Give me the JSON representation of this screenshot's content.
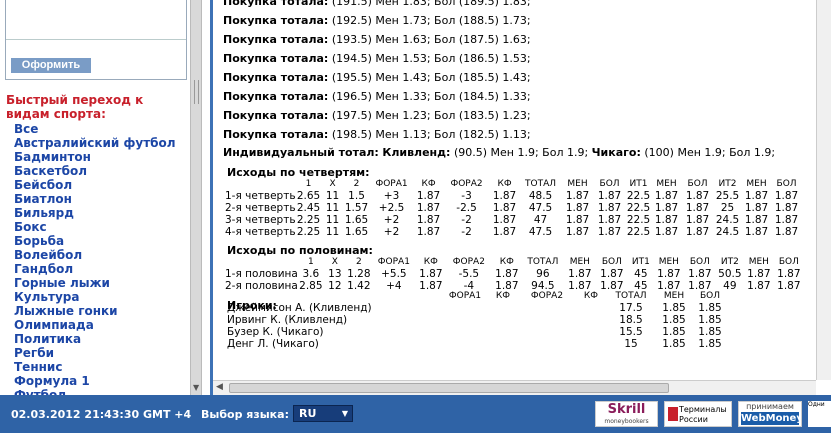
{
  "sidebar": {
    "order_button": "Оформить",
    "quick_title": "Быстрый переход к видам спорта:",
    "sports": [
      "Все",
      "Австралийский футбол",
      "Бадминтон",
      "Баскетбол",
      "Бейсбол",
      "Биатлон",
      "Бильярд",
      "Бокс",
      "Борьба",
      "Волейбол",
      "Гандбол",
      "Горные лыжи",
      "Культура",
      "Лыжные гонки",
      "Олимпиада",
      "Политика",
      "Регби",
      "Теннис",
      "Формула 1",
      "Футбол"
    ]
  },
  "totals": {
    "label": "Покупка тотала:",
    "lines": [
      "(191.5) Мен 1.83; Бол (189.5) 1.83;",
      "(192.5) Мен 1.73; Бол (188.5) 1.73;",
      "(193.5) Мен 1.63; Бол (187.5) 1.63;",
      "(194.5) Мен 1.53; Бол (186.5) 1.53;",
      "(195.5) Мен 1.43; Бол (185.5) 1.43;",
      "(196.5) Мен 1.33; Бол (184.5) 1.33;",
      "(197.5) Мен 1.23; Бол (183.5) 1.23;",
      "(198.5) Мен 1.13; Бол (182.5) 1.13;"
    ]
  },
  "individual": {
    "label": "Индивидуальный тотал:",
    "team1": "Кливленд:",
    "val1": "(90.5) Мен 1.9; Бол 1.9;",
    "team2": "Чикаго:",
    "val2": "(100) Мен 1.9; Бол 1.9;"
  },
  "quarters": {
    "title": "Исходы по четвертям:",
    "headers": [
      "1",
      "X",
      "2",
      "ФОРА1",
      "КФ",
      "ФОРА2",
      "КФ",
      "ТОТАЛ",
      "МЕН",
      "БОЛ",
      "ИТ1",
      "МЕН",
      "БОЛ",
      "ИТ2",
      "МЕН",
      "БОЛ"
    ],
    "rows": [
      {
        "label": "1-я четверть",
        "cells": [
          "2.65",
          "11",
          "1.5",
          "+3",
          "1.87",
          "-3",
          "1.87",
          "48.5",
          "1.87",
          "1.87",
          "22.5",
          "1.87",
          "1.87",
          "25.5",
          "1.87",
          "1.87"
        ]
      },
      {
        "label": "2-я четверть",
        "cells": [
          "2.45",
          "11",
          "1.57",
          "+2.5",
          "1.87",
          "-2.5",
          "1.87",
          "47.5",
          "1.87",
          "1.87",
          "22.5",
          "1.87",
          "1.87",
          "25",
          "1.87",
          "1.87"
        ]
      },
      {
        "label": "3-я четверть",
        "cells": [
          "2.25",
          "11",
          "1.65",
          "+2",
          "1.87",
          "-2",
          "1.87",
          "47",
          "1.87",
          "1.87",
          "22.5",
          "1.87",
          "1.87",
          "24.5",
          "1.87",
          "1.87"
        ]
      },
      {
        "label": "4-я четверть",
        "cells": [
          "2.25",
          "11",
          "1.65",
          "+2",
          "1.87",
          "-2",
          "1.87",
          "47.5",
          "1.87",
          "1.87",
          "22.5",
          "1.87",
          "1.87",
          "24.5",
          "1.87",
          "1.87"
        ]
      }
    ]
  },
  "halves": {
    "title": "Исходы по половинам:",
    "headers": [
      "1",
      "X",
      "2",
      "ФОРА1",
      "КФ",
      "ФОРА2",
      "КФ",
      "ТОТАЛ",
      "МЕН",
      "БОЛ",
      "ИТ1",
      "МЕН",
      "БОЛ",
      "ИТ2",
      "МЕН",
      "БОЛ"
    ],
    "rows": [
      {
        "label": "1-я половина",
        "cells": [
          "3.6",
          "13",
          "1.28",
          "+5.5",
          "1.87",
          "-5.5",
          "1.87",
          "96",
          "1.87",
          "1.87",
          "45",
          "1.87",
          "1.87",
          "50.5",
          "1.87",
          "1.87"
        ]
      },
      {
        "label": "2-я половина",
        "cells": [
          "2.85",
          "12",
          "1.42",
          "+4",
          "1.87",
          "-4",
          "1.87",
          "94.5",
          "1.87",
          "1.87",
          "45",
          "1.87",
          "1.87",
          "49",
          "1.87",
          "1.87"
        ]
      }
    ]
  },
  "players": {
    "title": "Игроки:",
    "headers": [
      "ФОРА1",
      "КФ",
      "ФОРА2",
      "КФ",
      "ТОТАЛ",
      "МЕН",
      "БОЛ"
    ],
    "rows": [
      {
        "name": "Джеймисон А. (Кливленд)",
        "cells": [
          "",
          "",
          "",
          "",
          "17.5",
          "1.85",
          "1.85"
        ]
      },
      {
        "name": "Ирвинг К. (Кливленд)",
        "cells": [
          "",
          "",
          "",
          "",
          "18.5",
          "1.85",
          "1.85"
        ]
      },
      {
        "name": "Бузер К. (Чикаго)",
        "cells": [
          "",
          "",
          "",
          "",
          "15.5",
          "1.85",
          "1.85"
        ]
      },
      {
        "name": "Денг Л. (Чикаго)",
        "cells": [
          "",
          "",
          "",
          "",
          "15",
          "1.85",
          "1.85"
        ]
      }
    ]
  },
  "footer": {
    "datetime": "02.03.2012  21:43:30  GMT +4",
    "lang_label": "Выбор языка:",
    "lang_value": "RU",
    "skrill": "Skrill",
    "skrill_sub": "moneybookers",
    "terminals": "Терминалы России",
    "webmoney_top": "принимаем",
    "webmoney": "WebMoney",
    "cut_text": "Одни"
  }
}
